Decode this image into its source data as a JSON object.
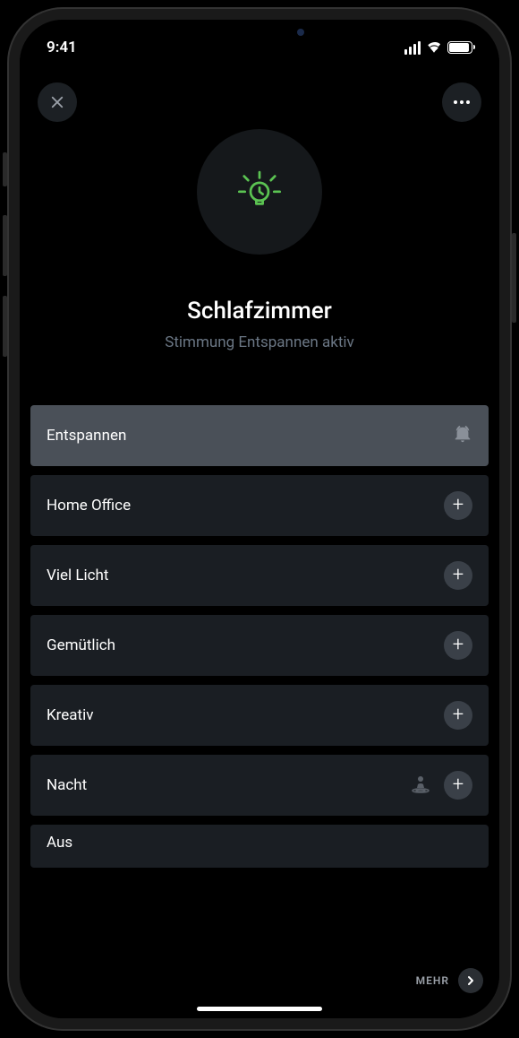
{
  "status": {
    "time": "9:41"
  },
  "header": {
    "title": "Schlafzimmer",
    "subtitle": "Stimmung Entspannen aktiv"
  },
  "accent_color": "#5bc352",
  "scenes": [
    {
      "label": "Entspannen",
      "active": true,
      "icon": "alarm"
    },
    {
      "label": "Home Office",
      "active": false,
      "icon": "plus"
    },
    {
      "label": "Viel Licht",
      "active": false,
      "icon": "plus"
    },
    {
      "label": "Gemütlich",
      "active": false,
      "icon": "plus"
    },
    {
      "label": "Kreativ",
      "active": false,
      "icon": "plus"
    },
    {
      "label": "Nacht",
      "active": false,
      "icon": "plus",
      "extra_icon": "presence"
    },
    {
      "label": "Aus",
      "active": false,
      "partial": true
    }
  ],
  "footer": {
    "label": "MEHR"
  }
}
